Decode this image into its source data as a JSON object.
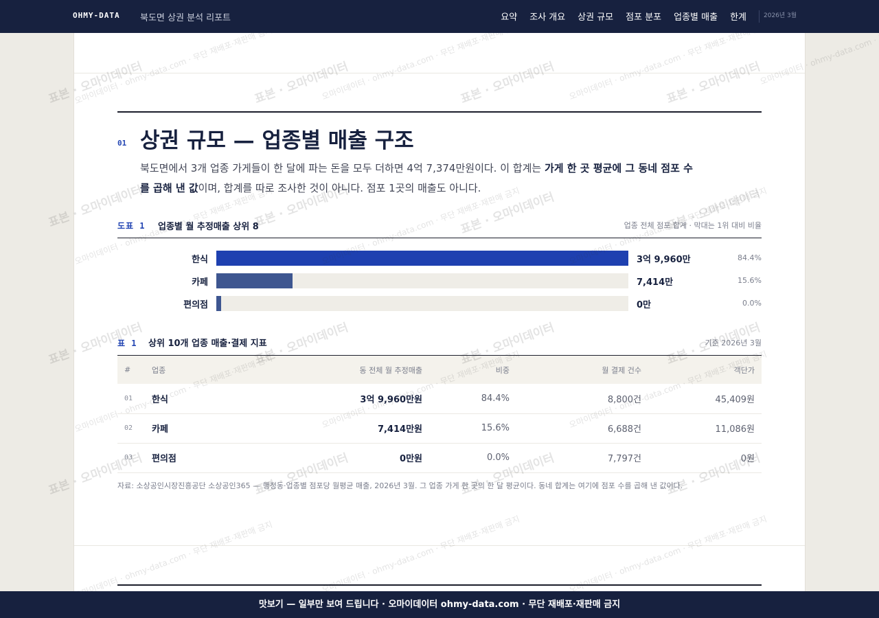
{
  "header": {
    "brand": "OHMY-DATA",
    "report_title": "북도면 상권 분석 리포트",
    "nav": [
      "요약",
      "조사 개요",
      "상권 규모",
      "점포 분포",
      "업종별 매출",
      "한계"
    ],
    "date": "2026년 3월"
  },
  "section": {
    "number": "01",
    "title": "상권 규모 — 업종별 매출 구조",
    "intro_1": "북도면에서 3개 업종 가게들이 한 달에 파는 돈을 모두 더하면 4억 7,374만원이다. 이 합계는 ",
    "intro_bold": "가게 한 곳 평균에 그 동네 점포 수를 곱해 낸 값",
    "intro_2": "이며, 합계를 따로 조사한 것이 아니다. 점포 1곳의 매출도 아니다."
  },
  "figure": {
    "label": "도표 1",
    "title": "업종별 월 추정매출 상위 8",
    "note": "업종 전체 점포 합계 · 막대는 1위 대비 비율"
  },
  "chart_data": {
    "type": "bar",
    "title": "업종별 월 추정매출 상위 8",
    "categories": [
      "한식",
      "카페",
      "편의점"
    ],
    "value_labels": [
      "3억 9,960만",
      "7,414만",
      "0만"
    ],
    "share_labels": [
      "84.4%",
      "15.6%",
      "0.0%"
    ],
    "values": [
      39960,
      7414,
      0
    ],
    "unit": "만원",
    "colors": [
      "#1e40b0",
      "#3e5690",
      "#3e5690"
    ]
  },
  "table": {
    "label": "표 1",
    "title": "상위 10개 업종 매출·결제 지표",
    "note": "기준 2026년 3월",
    "columns": [
      "#",
      "업종",
      "동 전체 월 추정매출",
      "비중",
      "월 결제 건수",
      "객단가"
    ],
    "rows": [
      [
        "01",
        "한식",
        "3억 9,960만원",
        "84.4%",
        "8,800건",
        "45,409원"
      ],
      [
        "02",
        "카페",
        "7,414만원",
        "15.6%",
        "6,688건",
        "11,086원"
      ],
      [
        "03",
        "편의점",
        "0만원",
        "0.0%",
        "7,797건",
        "0원"
      ]
    ]
  },
  "source": "자료: 소상공인시장진흥공단 소상공인365 — 행정동·업종별 점포당 월평균 매출, 2026년 3월. 그 업종 가게 한 곳의 한 달 평균이다. 동네 합계는 여기에 점포 수를 곱해 낸 값이다.",
  "watermark": {
    "big": "표본 · 오마이데이터",
    "small": "오마이데이터 · ohmy-data.com · 무단 재배포·재판매 금지"
  },
  "footer": "맛보기 — 일부만 보여 드립니다 · 오마이데이터 ohmy-data.com · 무단 재배포·재판매 금지"
}
